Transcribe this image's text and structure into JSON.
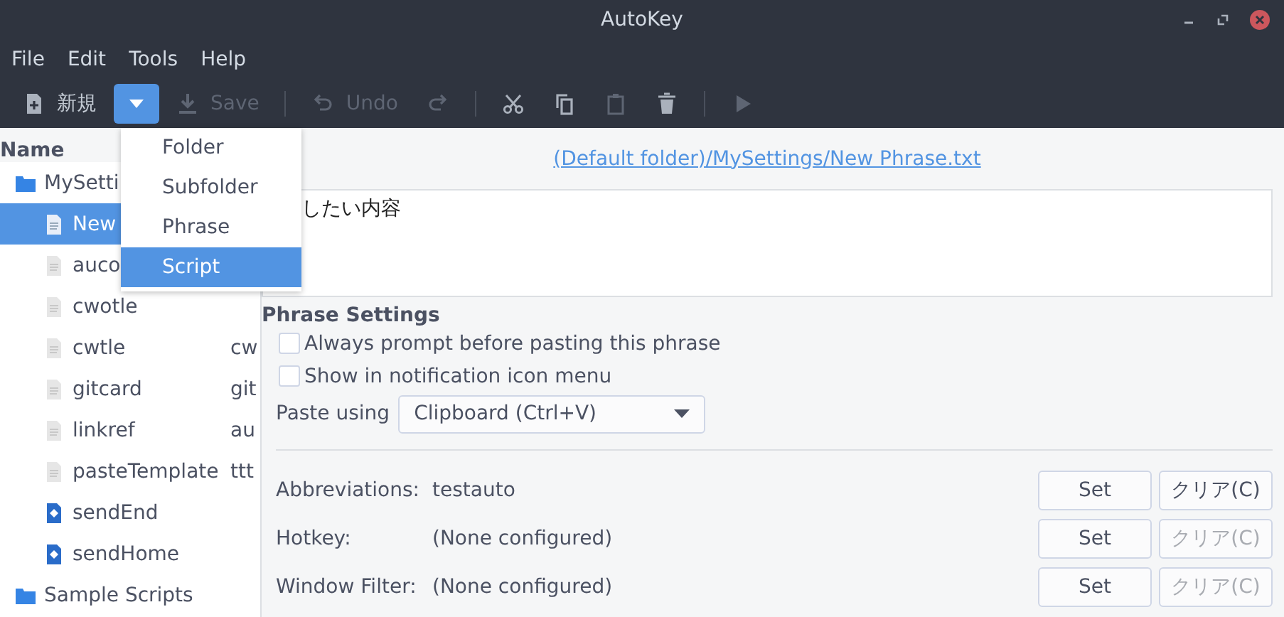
{
  "window": {
    "title": "AutoKey"
  },
  "menu_bar": [
    "File",
    "Edit",
    "Tools",
    "Help"
  ],
  "toolbar": {
    "new": {
      "label": "新規",
      "disabled": false
    },
    "dropdown": {
      "open": true
    },
    "save": {
      "label": "Save",
      "disabled": true
    },
    "undo": {
      "label": "Undo",
      "disabled": true
    },
    "redo": {
      "disabled": true
    },
    "cut": {
      "disabled": false
    },
    "copy": {
      "disabled": false
    },
    "paste": {
      "disabled": true
    },
    "delete": {
      "disabled": false
    },
    "run": {
      "disabled": true
    }
  },
  "new_menu": [
    {
      "label": "Folder",
      "selected": false
    },
    {
      "label": "Subfolder",
      "selected": false
    },
    {
      "label": "Phrase",
      "selected": false
    },
    {
      "label": "Script",
      "selected": true
    }
  ],
  "tree": {
    "header": "Name",
    "items": [
      {
        "label": "MySetti",
        "kind": "folder",
        "selected": false,
        "children": [
          {
            "label": "New",
            "kind": "phrase",
            "selected": true
          },
          {
            "label": "auco",
            "kind": "phrase",
            "selected": false
          },
          {
            "label": "cwotle",
            "kind": "phrase",
            "selected": false
          },
          {
            "label": "cwtle",
            "kind": "phrase",
            "selected": false,
            "column_2": "cw"
          },
          {
            "label": "gitcard",
            "kind": "phrase",
            "selected": false,
            "column_2": "git"
          },
          {
            "label": "linkref",
            "kind": "phrase",
            "selected": false,
            "column_2": "au"
          },
          {
            "label": "pasteTemplate",
            "kind": "phrase",
            "selected": false,
            "column_2": "ttt"
          },
          {
            "label": "sendEnd",
            "kind": "script",
            "selected": false
          },
          {
            "label": "sendHome",
            "kind": "script",
            "selected": false
          }
        ]
      },
      {
        "label": "Sample Scripts",
        "kind": "folder",
        "selected": false
      }
    ]
  },
  "editor": {
    "path_link": "(Default folder)/MySettings/New Phrase.txt",
    "text": "したい内容"
  },
  "phrase_settings": {
    "title": "Phrase Settings",
    "options": [
      {
        "label": "Always prompt before pasting this phrase",
        "checked": false
      },
      {
        "label": "Show in notification icon menu",
        "checked": false
      }
    ],
    "paste_label": "Paste using",
    "paste_value": "Clipboard (Ctrl+V)"
  },
  "bindings": [
    {
      "label": "Abbreviations:",
      "value": "testauto",
      "set": "Set",
      "clear": "クリア(C)",
      "clear_disabled": false
    },
    {
      "label": "Hotkey:",
      "value": "(None configured)",
      "set": "Set",
      "clear": "クリア(C)",
      "clear_disabled": true
    },
    {
      "label": "Window Filter:",
      "value": "(None configured)",
      "set": "Set",
      "clear": "クリア(C)",
      "clear_disabled": true
    }
  ]
}
